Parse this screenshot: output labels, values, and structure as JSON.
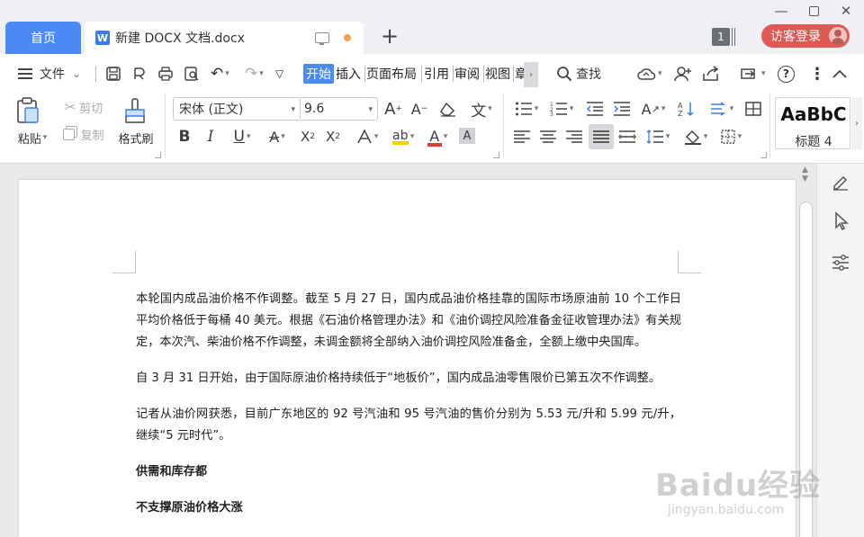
{
  "tabs": {
    "home": "首页",
    "document": "新建 DOCX 文档.docx",
    "new_tab": "+"
  },
  "window": {
    "count_badge": "1",
    "login_button": "访客登录"
  },
  "menu": {
    "file": "文件",
    "tabs": [
      "开始",
      "插入",
      "页面布局",
      "引用",
      "审阅",
      "视图",
      "章"
    ],
    "search": "查找"
  },
  "clipboard": {
    "paste": "粘贴",
    "cut": "剪切",
    "copy": "复制",
    "format_painter": "格式刷"
  },
  "font": {
    "family": "宋体 (正文)",
    "size": "9.6"
  },
  "style_gallery": {
    "sample": "AaBbC",
    "name": "标题 4"
  },
  "document": {
    "paragraphs": [
      "本轮国内成品油价格不作调整。截至 5 月 27 日，国内成品油价格挂靠的国际市场原油前 10 个工作日平均价格低于每桶 40 美元。根据《石油价格管理办法》和《油价调控风险准备金征收管理办法》有关规定，本次汽、柴油价格不作调整，未调金额将全部纳入油价调控风险准备金，全额上缴中央国库。",
      "自 3 月 31 日开始，由于国际原油价格持续低于“地板价”，国内成品油零售限价已第五次不作调整。",
      "记者从油价网获悉，目前广东地区的 92 号汽油和 95 号汽油的售价分别为 5.53 元/升和 5.99 元/升，继续“5 元时代”。",
      "供需和库存都",
      "不支撑原油价格大涨"
    ]
  },
  "watermark": {
    "main": "Baidu经验",
    "sub": "jingyan.baidu.com"
  },
  "colors": {
    "accent": "#4a8af4",
    "login": "#e05a55",
    "highlight": "#f2d200",
    "font_color": "#e53935"
  },
  "icons": {
    "undo": "↶",
    "redo": "↷",
    "help": "?",
    "more": "⋮",
    "collapse": "︿"
  }
}
